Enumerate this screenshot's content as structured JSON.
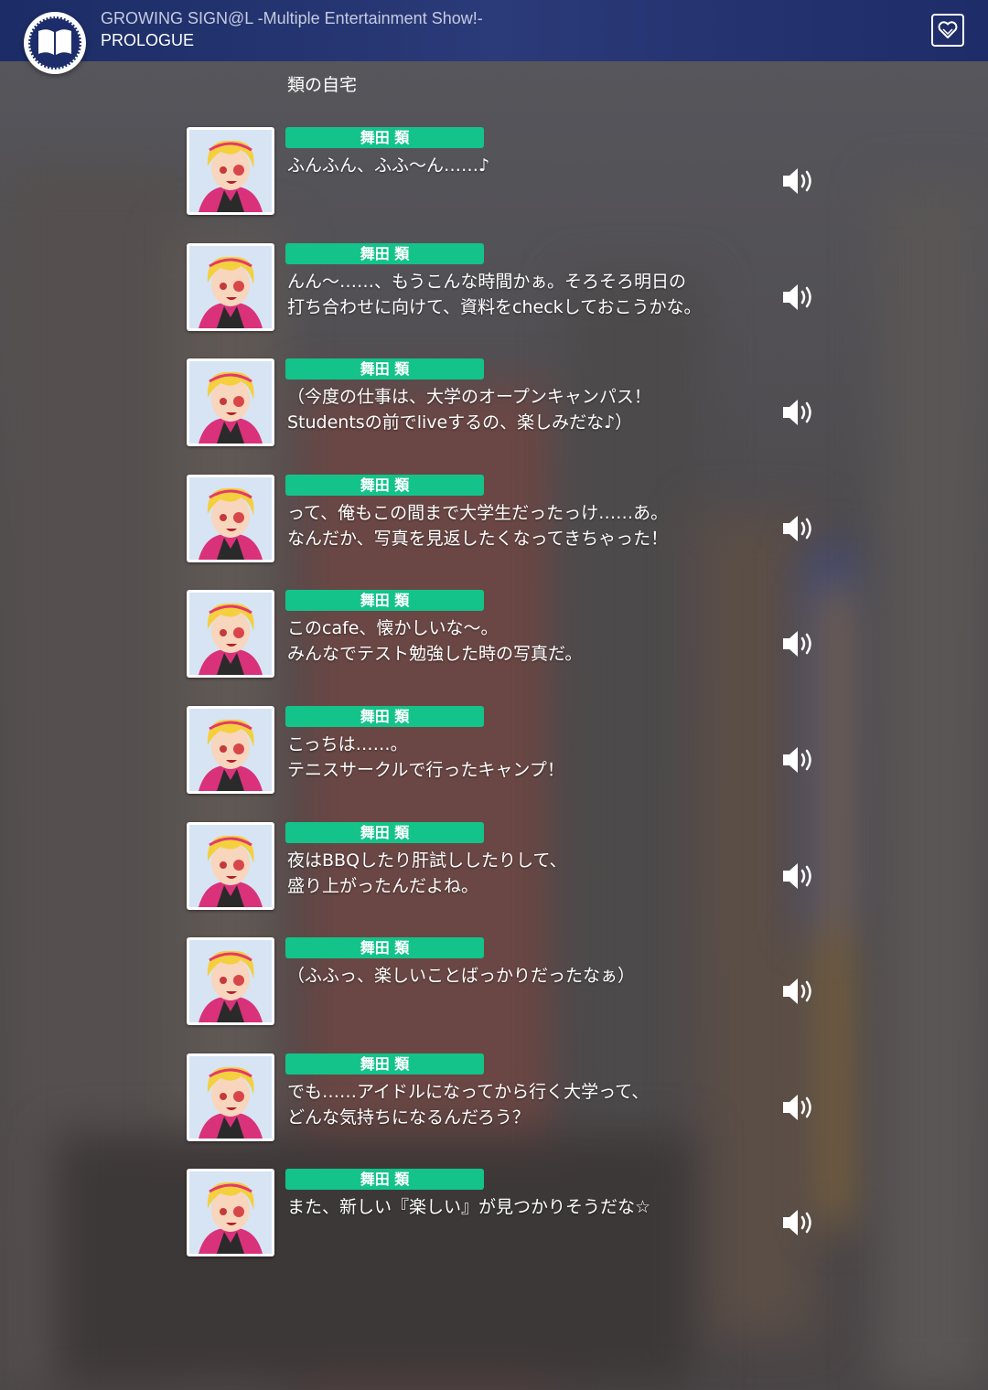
{
  "header": {
    "title": "GROWING SIGN@L -Multiple Entertainment Show!-",
    "subtitle": "PROLOGUE"
  },
  "icons": {
    "menu": "book-icon",
    "favorite": "heart-icon",
    "voice": "speaker-icon"
  },
  "location": "類の自宅",
  "dialogues": [
    {
      "speaker": "舞田 類",
      "lines": [
        "ふんふん、ふふ～ん……♪"
      ]
    },
    {
      "speaker": "舞田 類",
      "lines": [
        "んん～……、もうこんな時間かぁ。そろそろ明日の",
        "打ち合わせに向けて、資料をcheckしておこうかな。"
      ]
    },
    {
      "speaker": "舞田 類",
      "lines": [
        "（今度の仕事は、大学のオープンキャンパス！",
        "Studentsの前でliveするの、楽しみだな♪）"
      ]
    },
    {
      "speaker": "舞田 類",
      "lines": [
        "って、俺もこの間まで大学生だったっけ……あ。",
        "なんだか、写真を見返したくなってきちゃった！"
      ]
    },
    {
      "speaker": "舞田 類",
      "lines": [
        "このcafe、懐かしいな～。",
        "みんなでテスト勉強した時の写真だ。"
      ]
    },
    {
      "speaker": "舞田 類",
      "lines": [
        "こっちは……。",
        "テニスサークルで行ったキャンプ！"
      ]
    },
    {
      "speaker": "舞田 類",
      "lines": [
        "夜はBBQしたり肝試ししたりして、",
        "盛り上がったんだよね。"
      ]
    },
    {
      "speaker": "舞田 類",
      "lines": [
        "（ふふっ、楽しいことばっかりだったなぁ）"
      ]
    },
    {
      "speaker": "舞田 類",
      "lines": [
        "でも……アイドルになってから行く大学って、",
        "どんな気持ちになるんだろう？"
      ]
    },
    {
      "speaker": "舞田 類",
      "lines": [
        "また、新しい『楽しい』が見つかりそうだな☆"
      ]
    }
  ],
  "colors": {
    "header_bg": "#1e2c69",
    "name_tag_bg": "#14c38a",
    "text": "#ffffff"
  }
}
